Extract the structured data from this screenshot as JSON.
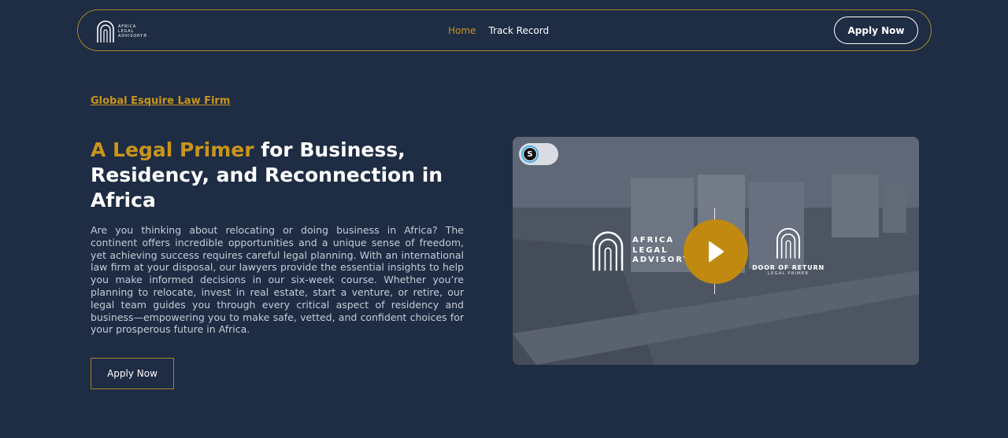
{
  "nav": {
    "logo_lines": [
      "AFRICA",
      "LEGAL",
      "ADVISORY®"
    ],
    "links": [
      "Home",
      "Track Record"
    ],
    "apply_label": "Apply Now"
  },
  "hero": {
    "firm_link": "Global Esquire Law Firm",
    "headline_highlight": "A Legal Primer",
    "headline_rest": " for Business, Residency, and Reconnection in Africa",
    "description": "Are you thinking about relocating or doing business in Africa? The continent offers incredible opportunities and a unique sense of freedom, yet achieving success requires careful legal planning. With an international law firm at your disposal, our lawyers provide the essential insights to help you make informed decisions in our six-week course. Whether you’re planning to relocate, invest in real estate, start a venture, or retire, our legal team guides you through every critical aspect of residency and business—empowering you to make safe, vetted, and confident choices for your prosperous future in Africa.",
    "apply_label": "Apply Now"
  },
  "video": {
    "toggle_letter": "S",
    "logo_lines": [
      "AFRICA",
      "LEGAL",
      "ADVISORY"
    ],
    "door_title": "DOOR OF RETURN",
    "door_subtitle": "LEGAL PRIMER"
  },
  "colors": {
    "background": "#1e2c44",
    "gold": "#c9951a",
    "play": "#c08a10"
  }
}
